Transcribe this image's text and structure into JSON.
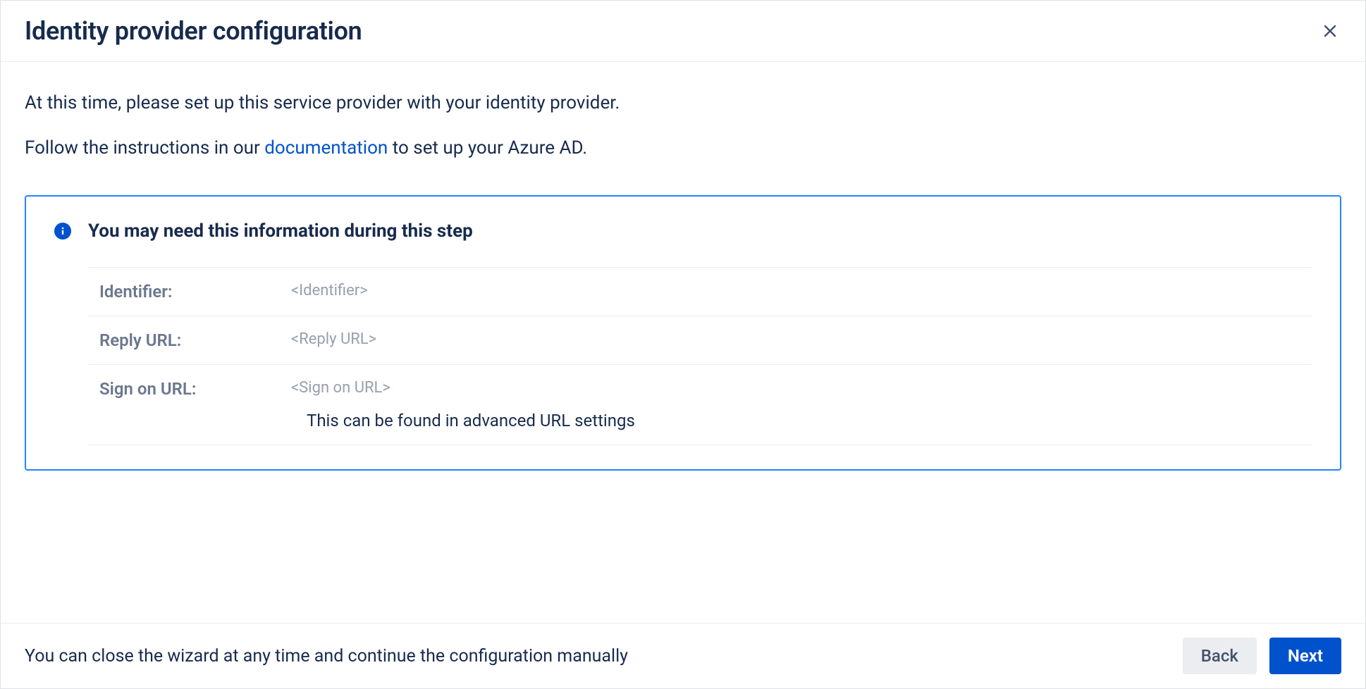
{
  "header": {
    "title": "Identity provider configuration"
  },
  "intro": {
    "line1": "At this time, please set up this service provider with your identity provider.",
    "line2_pre": "Follow the instructions in our ",
    "line2_link": "documentation",
    "line2_post": " to set up your Azure AD."
  },
  "info_panel": {
    "title": "You may need this information during this step",
    "rows": [
      {
        "label": "Identifier:",
        "value": "<Identifier>",
        "helper": null
      },
      {
        "label": "Reply URL:",
        "value": "<Reply URL>",
        "helper": null
      },
      {
        "label": "Sign on URL:",
        "value": "<Sign on URL>",
        "helper": "This can be found in advanced URL settings"
      }
    ]
  },
  "footer": {
    "hint": "You can close the wizard at any time and continue the configuration manually",
    "back": "Back",
    "next": "Next"
  }
}
